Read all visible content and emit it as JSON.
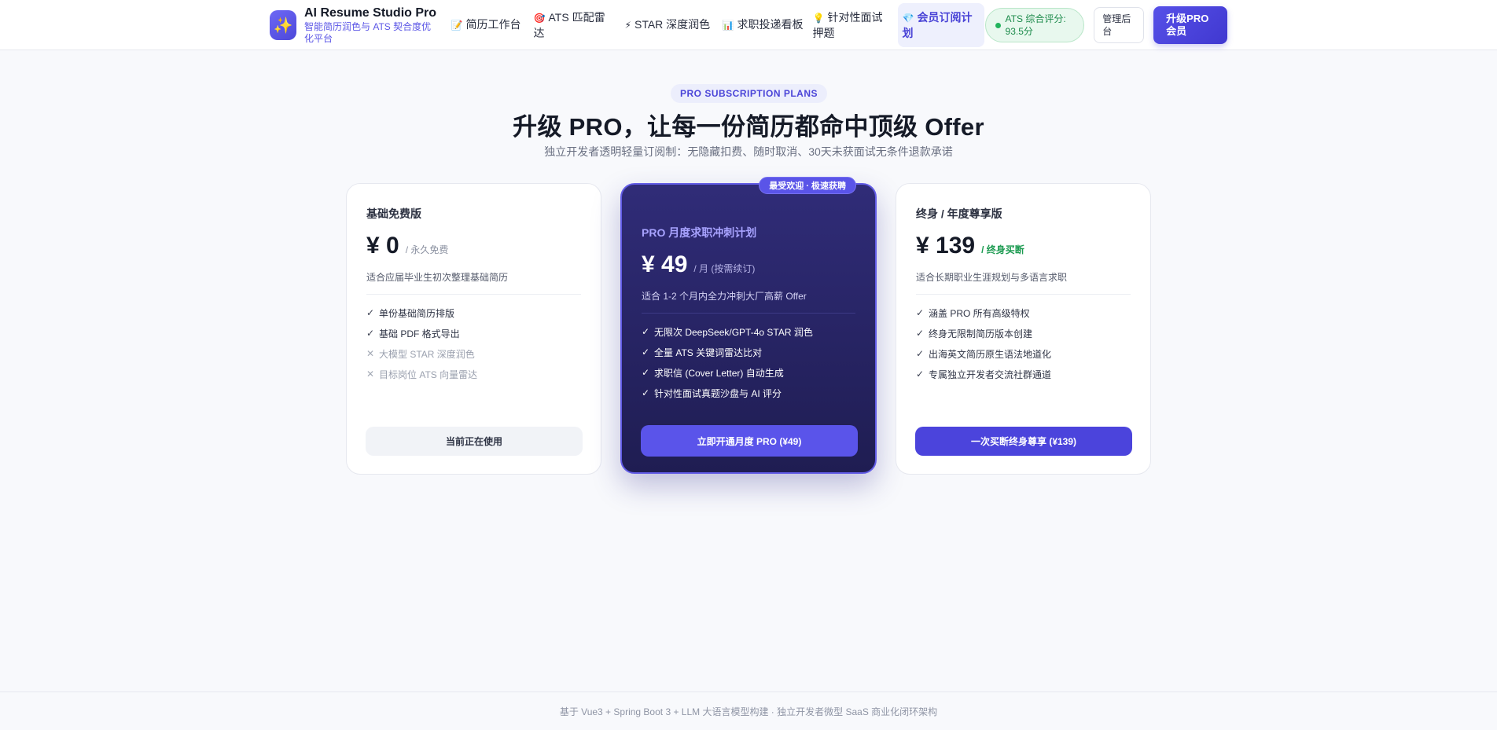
{
  "brand": {
    "title": "AI Resume Studio Pro",
    "subtitle": "智能简历润色与 ATS 契合度优化平台",
    "logo_icon": "sparkles-icon"
  },
  "nav": [
    {
      "icon": "📝",
      "label": "简历工作台"
    },
    {
      "icon": "🎯",
      "label": "ATS 匹配雷达"
    },
    {
      "icon": "⚡",
      "label": "STAR 深度润色"
    },
    {
      "icon": "📊",
      "label": "求职投递看板"
    },
    {
      "icon": "💡",
      "label": "针对性面试押题"
    },
    {
      "icon": "💎",
      "label": "会员订阅计划"
    }
  ],
  "ats_badge": {
    "label": "ATS 综合评分: 93.5分"
  },
  "admin_label": "管理后台",
  "upgrade_label": "升级PRO会员",
  "hero": {
    "tag": "PRO SUBSCRIPTION PLANS",
    "title": "升级 PRO，让每一份简历都命中顶级 Offer",
    "subtitle": "独立开发者透明轻量订阅制：无隐藏扣费、随时取消、30天未获面试无条件退款承诺"
  },
  "plans": [
    {
      "name": "基础免费版",
      "price": "¥ 0",
      "period": "/ 永久免费",
      "desc": "适合应届毕业生初次整理基础简历",
      "features": [
        {
          "text": "单份基础简历排版",
          "enabled": true
        },
        {
          "text": "基础 PDF 格式导出",
          "enabled": true
        },
        {
          "text": "大模型 STAR 深度润色",
          "enabled": false
        },
        {
          "text": "目标岗位 ATS 向量雷达",
          "enabled": false
        }
      ],
      "button": "当前正在使用"
    },
    {
      "ribbon": "最受欢迎 · 极速获聘",
      "name": "PRO 月度求职冲刺计划",
      "price": "¥ 49",
      "period": "/ 月 (按需续订)",
      "desc": "适合 1-2 个月内全力冲刺大厂高薪 Offer",
      "features": [
        {
          "text": "无限次 DeepSeek/GPT-4o STAR 润色",
          "enabled": true
        },
        {
          "text": "全量 ATS 关键词雷达比对",
          "enabled": true
        },
        {
          "text": "求职信 (Cover Letter) 自动生成",
          "enabled": true
        },
        {
          "text": "针对性面试真题沙盘与 AI 评分",
          "enabled": true
        }
      ],
      "button": "立即开通月度 PRO (¥49)"
    },
    {
      "name": "终身 / 年度尊享版",
      "price": "¥ 139",
      "period": "/ 终身买断",
      "desc": "适合长期职业生涯规划与多语言求职",
      "features": [
        {
          "text": "涵盖 PRO 所有高级特权",
          "enabled": true
        },
        {
          "text": "终身无限制简历版本创建",
          "enabled": true
        },
        {
          "text": "出海英文简历原生语法地道化",
          "enabled": true
        },
        {
          "text": "专属独立开发者交流社群通道",
          "enabled": true
        }
      ],
      "button": "一次买断终身尊享 (¥139)"
    }
  ],
  "marks": {
    "enabled": "✓",
    "disabled": "✕"
  },
  "footer": "基于 Vue3 + Spring Boot 3 + LLM 大语言模型构建 · 独立开发者微型 SaaS 商业化闭环架构",
  "colors": {
    "accent": "#4f49e0",
    "pro_card_bg": "#2a2768",
    "success": "#1b9a50"
  }
}
